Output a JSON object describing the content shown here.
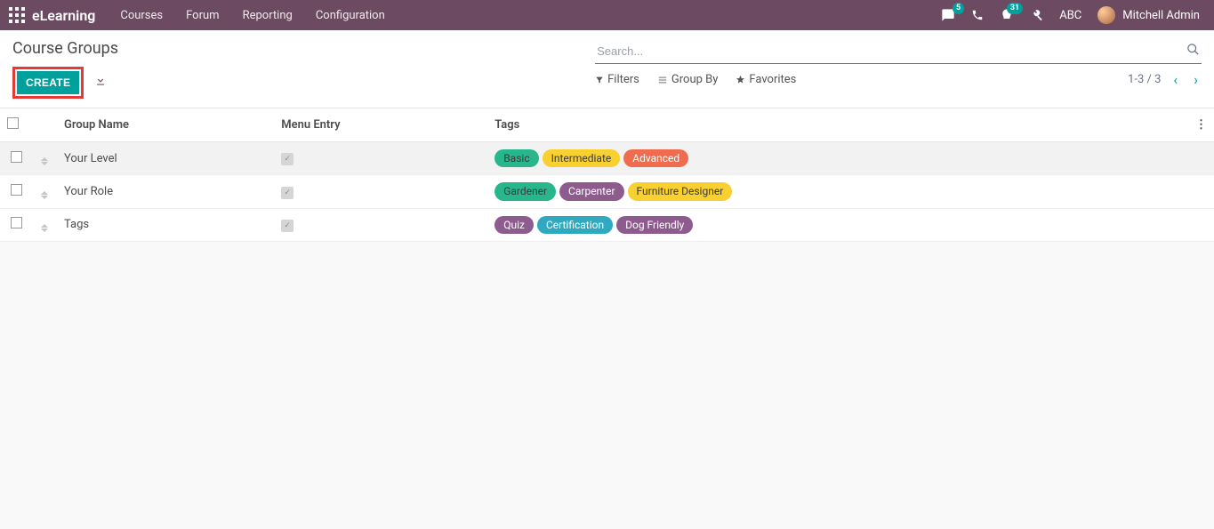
{
  "topnav": {
    "brand": "eLearning",
    "menu": [
      "Courses",
      "Forum",
      "Reporting",
      "Configuration"
    ],
    "messages_badge": "5",
    "activities_badge": "31",
    "abc": "ABC",
    "user_name": "Mitchell Admin"
  },
  "header": {
    "title": "Course Groups",
    "create_label": "CREATE",
    "search_placeholder": "Search...",
    "filters_label": "Filters",
    "groupby_label": "Group By",
    "favorites_label": "Favorites",
    "pager": "1-3 / 3"
  },
  "columns": {
    "group_name": "Group Name",
    "menu_entry": "Menu Entry",
    "tags": "Tags"
  },
  "tag_colors": {
    "green": "#28b78d",
    "yellow": "#f8d030",
    "orange": "#f06c4f",
    "purple": "#8e5b8e",
    "teal": "#2fa9bf"
  },
  "rows": [
    {
      "name": "Your Level",
      "menu_entry": true,
      "hovered": true,
      "tags": [
        {
          "label": "Basic",
          "color": "green",
          "dark": true
        },
        {
          "label": "Intermediate",
          "color": "yellow",
          "dark": true
        },
        {
          "label": "Advanced",
          "color": "orange",
          "dark": false
        }
      ]
    },
    {
      "name": "Your Role",
      "menu_entry": true,
      "hovered": false,
      "tags": [
        {
          "label": "Gardener",
          "color": "green",
          "dark": true
        },
        {
          "label": "Carpenter",
          "color": "purple",
          "dark": false
        },
        {
          "label": "Furniture Designer",
          "color": "yellow",
          "dark": true
        }
      ]
    },
    {
      "name": "Tags",
      "menu_entry": true,
      "hovered": false,
      "tags": [
        {
          "label": "Quiz",
          "color": "purple",
          "dark": false
        },
        {
          "label": "Certification",
          "color": "teal",
          "dark": false
        },
        {
          "label": "Dog Friendly",
          "color": "purple",
          "dark": false
        }
      ]
    }
  ]
}
